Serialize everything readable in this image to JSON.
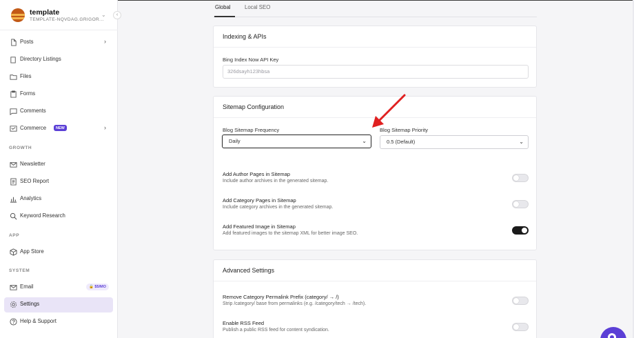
{
  "brand": {
    "name": "template",
    "subtitle": "TEMPLATE-NQVDAG.GRIGOR..."
  },
  "sidebar": {
    "main_items": [
      {
        "label": "Posts",
        "icon": "document-icon",
        "has_chevron": true
      },
      {
        "label": "Directory Listings",
        "icon": "book-icon"
      },
      {
        "label": "Files",
        "icon": "folder-icon"
      },
      {
        "label": "Forms",
        "icon": "clipboard-icon"
      },
      {
        "label": "Comments",
        "icon": "comment-icon"
      },
      {
        "label": "Commerce",
        "icon": "cart-icon",
        "badge": "NEW",
        "has_chevron": true
      }
    ],
    "growth_label": "GROWTH",
    "growth_items": [
      {
        "label": "Newsletter",
        "icon": "mail-icon"
      },
      {
        "label": "SEO Report",
        "icon": "report-icon"
      },
      {
        "label": "Analytics",
        "icon": "chart-icon"
      },
      {
        "label": "Keyword Research",
        "icon": "search-icon"
      }
    ],
    "app_label": "APP",
    "app_items": [
      {
        "label": "App Store",
        "icon": "box-icon"
      }
    ],
    "system_label": "SYSTEM",
    "system_items": [
      {
        "label": "Email",
        "icon": "mail-icon",
        "badge": "$5/MO"
      },
      {
        "label": "Settings",
        "icon": "gear-icon",
        "active": true
      },
      {
        "label": "Help & Support",
        "icon": "help-icon"
      }
    ]
  },
  "tabs": [
    {
      "label": "Global",
      "active": true
    },
    {
      "label": "Local SEO"
    }
  ],
  "indexing": {
    "title": "Indexing & APIs",
    "bing_label": "Bing Index Now API Key",
    "bing_value": "326dsayh123hbsa"
  },
  "sitemap": {
    "title": "Sitemap Configuration",
    "frequency_label": "Blog Sitemap Frequency",
    "frequency_value": "Daily",
    "priority_label": "Blog Sitemap Priority",
    "priority_value": "0.5 (Default)",
    "toggles": [
      {
        "title": "Add Author Pages in Sitemap",
        "desc": "Include author archives in the generated sitemap.",
        "on": false
      },
      {
        "title": "Add Category Pages in Sitemap",
        "desc": "Include category archives in the generated sitemap.",
        "on": false
      },
      {
        "title": "Add Featured Image in Sitemap",
        "desc": "Add featured images to the sitemap XML for better image SEO.",
        "on": true
      }
    ]
  },
  "advanced": {
    "title": "Advanced Settings",
    "toggles": [
      {
        "title": "Remove Category Permalink Prefix (category/ → /)",
        "desc": "Strip /category/ base from permalinks (e.g. /category/tech → /tech).",
        "on": false
      },
      {
        "title": "Enable RSS Feed",
        "desc": "Publish a public RSS feed for content syndication.",
        "on": false
      }
    ]
  },
  "colors": {
    "accent": "#5b3fd6",
    "arrow": "#e02020",
    "active_bg": "#e9e4f7"
  }
}
